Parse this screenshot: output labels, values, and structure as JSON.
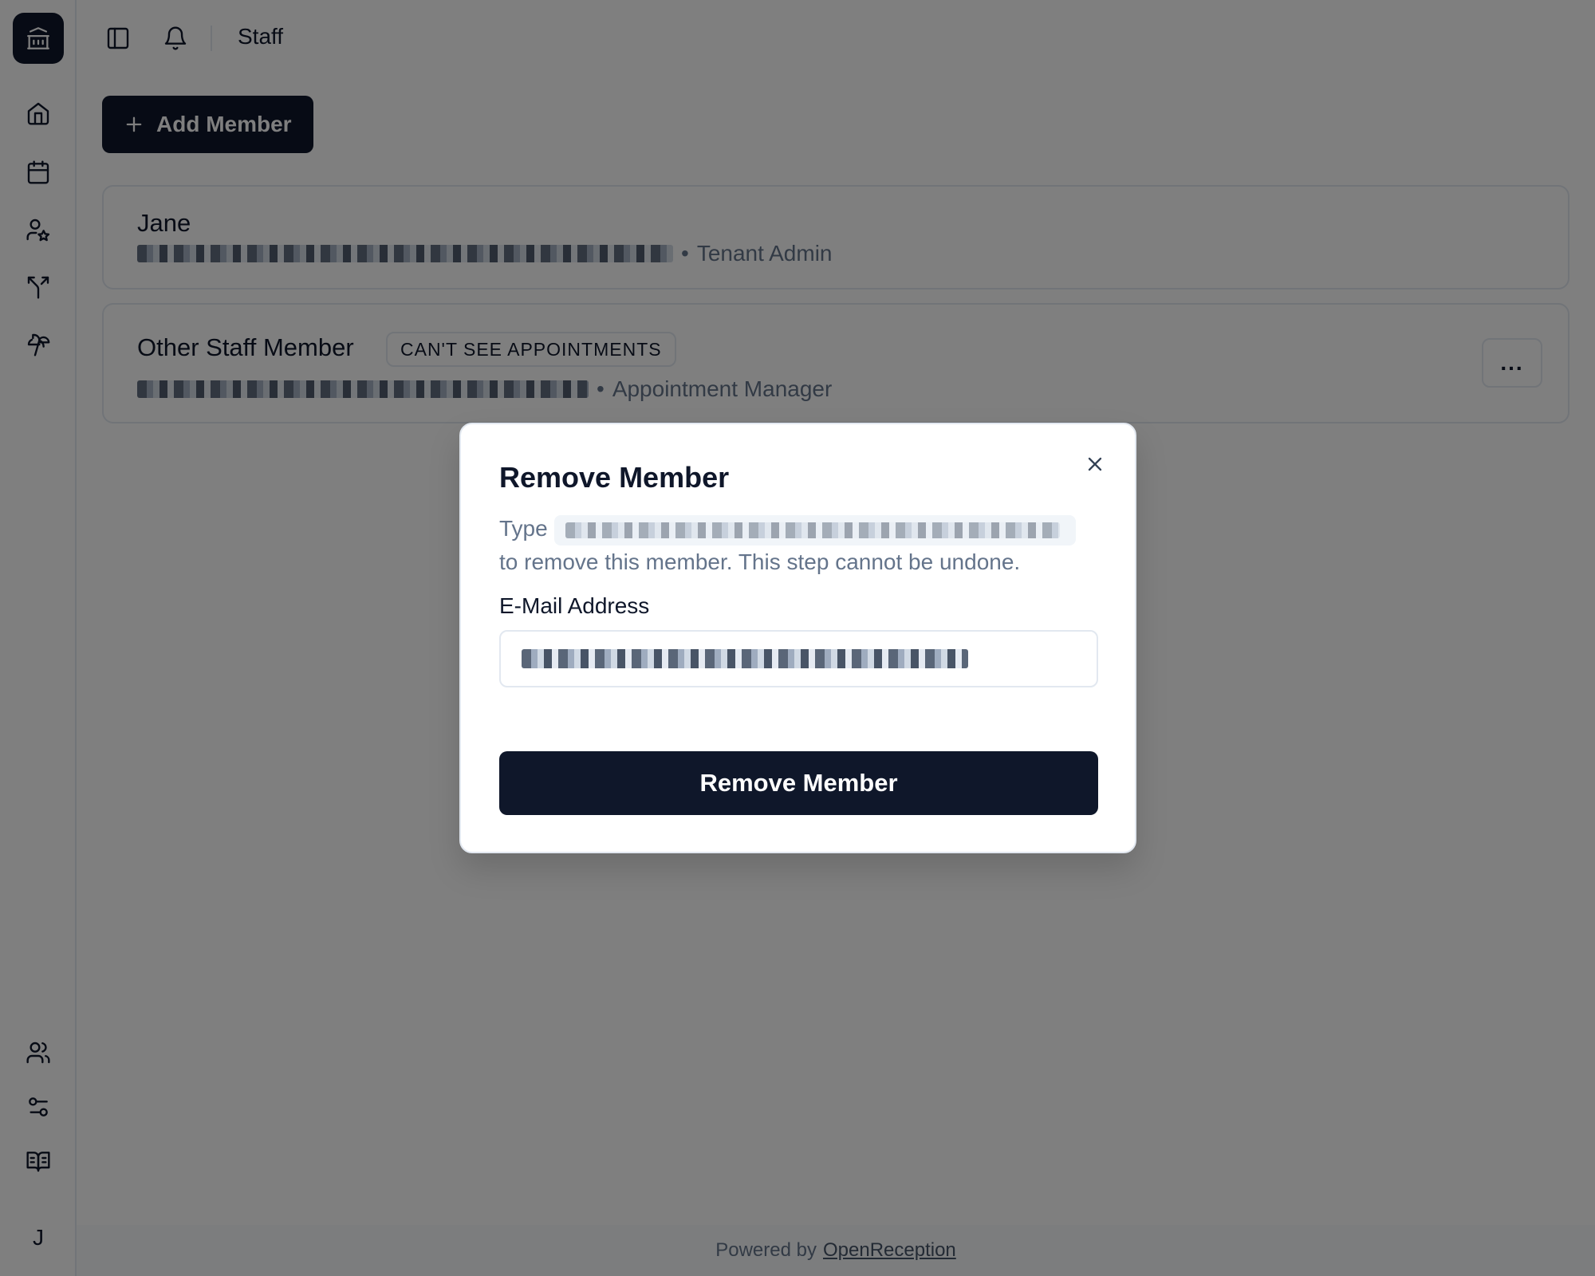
{
  "header": {
    "page_title": "Staff"
  },
  "sidebar": {
    "logo_icon": "bank-icon",
    "items": [
      {
        "icon": "home-icon"
      },
      {
        "icon": "calendar-icon"
      },
      {
        "icon": "user-star-icon"
      },
      {
        "icon": "split-arrows-icon"
      },
      {
        "icon": "palm-tree-icon"
      }
    ],
    "bottom_items": [
      {
        "icon": "users-icon"
      },
      {
        "icon": "sliders-icon"
      },
      {
        "icon": "book-open-icon"
      }
    ],
    "user_initial": "J"
  },
  "main": {
    "add_member_label": "Add Member",
    "members": [
      {
        "name": "Jane",
        "role": "Tenant Admin",
        "badge": ""
      },
      {
        "name": "Other Staff Member",
        "role": "Appointment Manager",
        "badge": "CAN'T SEE APPOINTMENTS"
      }
    ],
    "more_label": "..."
  },
  "footer": {
    "powered_by": "Powered by",
    "link": "OpenReception"
  },
  "modal": {
    "title": "Remove Member",
    "desc_prefix": "Type",
    "desc_suffix": "to remove this member. This step cannot be undone.",
    "field_label": "E-Mail Address",
    "submit_label": "Remove Member"
  },
  "colors": {
    "primary": "#0f172a",
    "muted_text": "#64748b",
    "border": "#e2e8f0",
    "overlay": "rgba(0,0,0,0.5)"
  }
}
